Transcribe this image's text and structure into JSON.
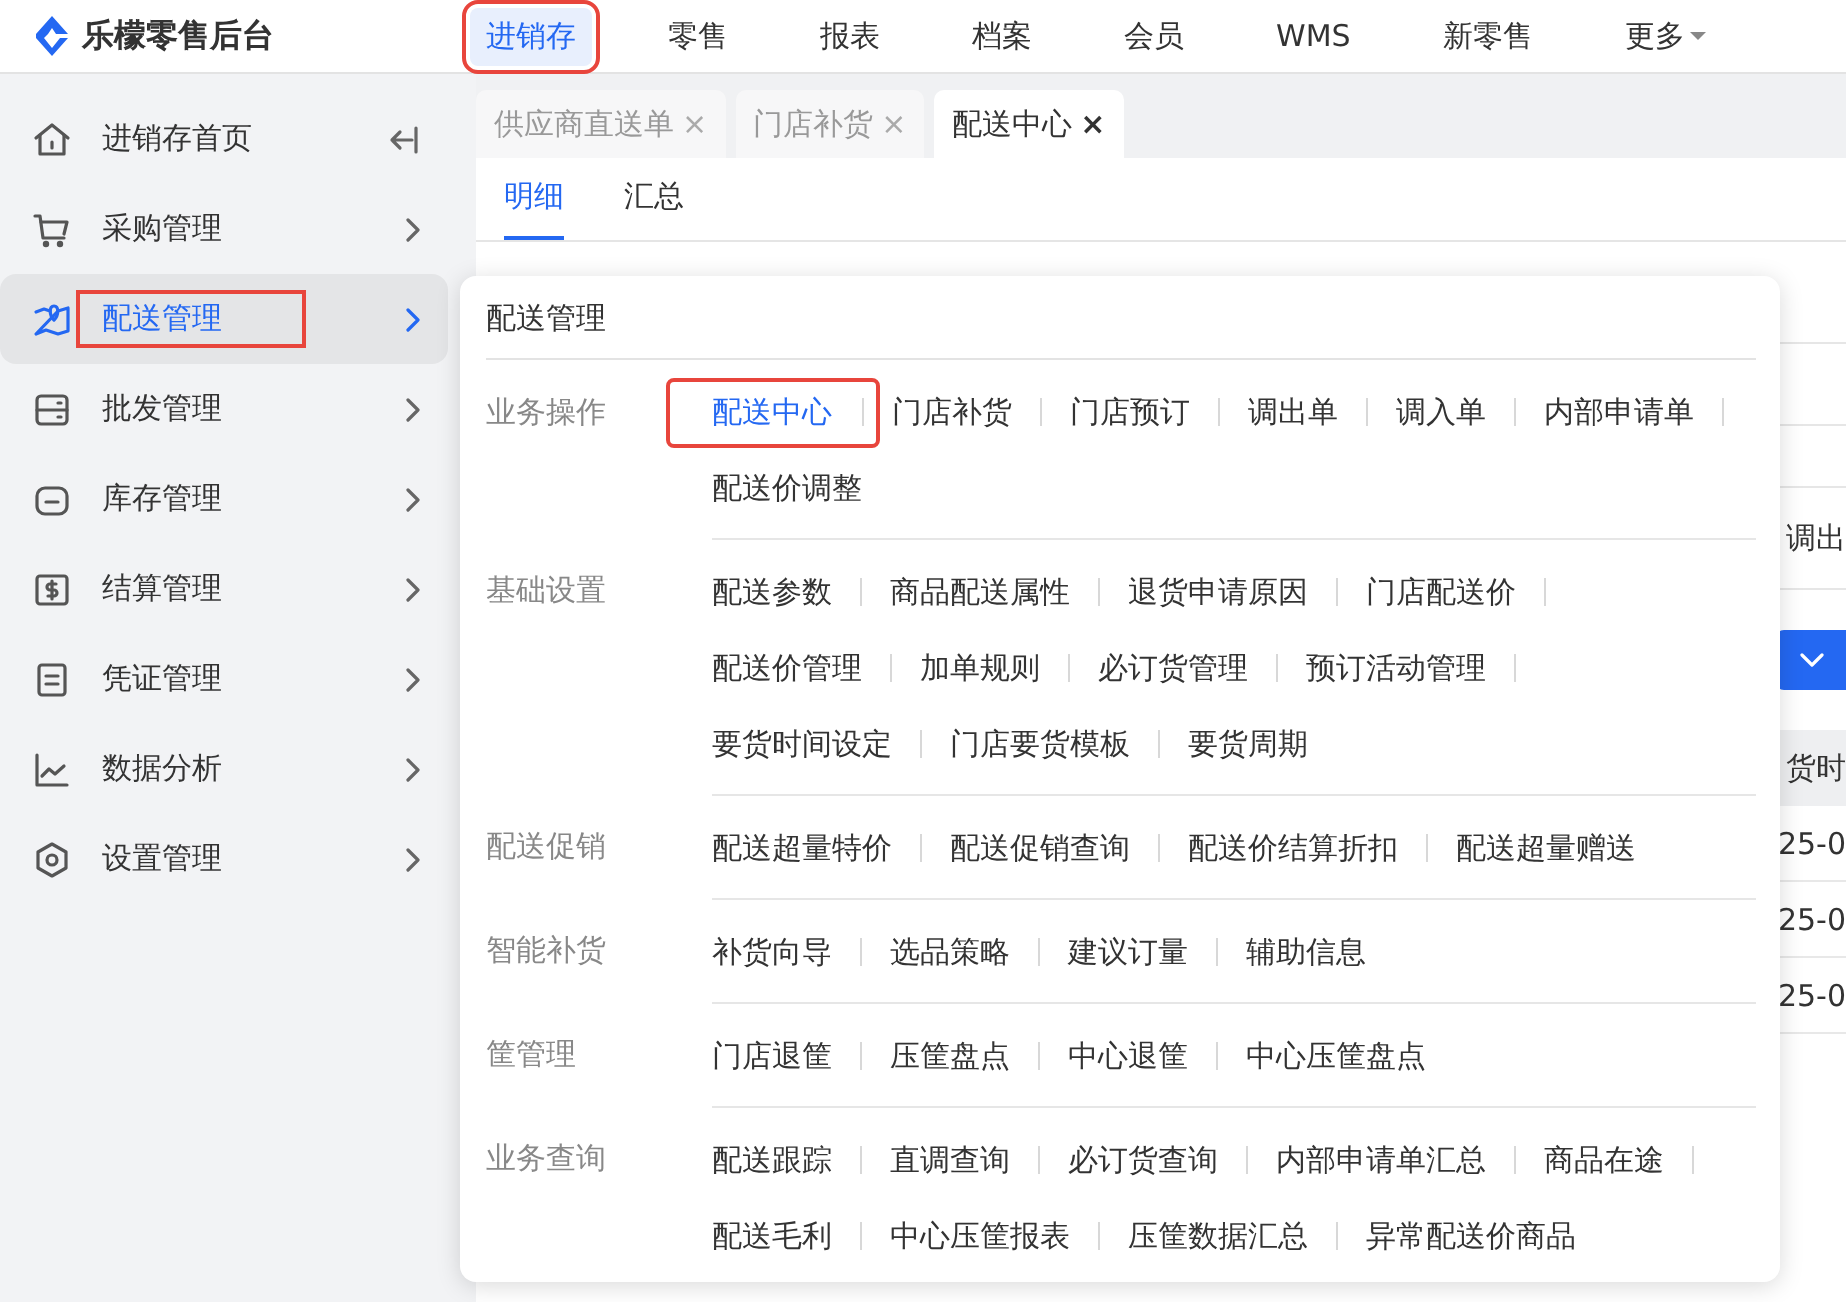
{
  "logo": {
    "title": "乐檬零售后台"
  },
  "top_nav": [
    {
      "label": "进销存",
      "selected": true,
      "annotated": true,
      "kind": "link"
    },
    {
      "label": "零售",
      "selected": false,
      "annotated": false,
      "kind": "link"
    },
    {
      "label": "报表",
      "selected": false,
      "annotated": false,
      "kind": "link"
    },
    {
      "label": "档案",
      "selected": false,
      "annotated": false,
      "kind": "link"
    },
    {
      "label": "会员",
      "selected": false,
      "annotated": false,
      "kind": "link"
    },
    {
      "label": "WMS",
      "selected": false,
      "annotated": false,
      "kind": "link"
    },
    {
      "label": "新零售",
      "selected": false,
      "annotated": false,
      "kind": "link"
    },
    {
      "label": "更多",
      "selected": false,
      "annotated": false,
      "kind": "dropdown"
    }
  ],
  "sidebar": {
    "items": [
      {
        "label": "进销存首页",
        "selected": false,
        "annotated": false,
        "kind": "page"
      },
      {
        "label": "采购管理",
        "selected": false,
        "annotated": false,
        "kind": "submenu"
      },
      {
        "label": "配送管理",
        "selected": true,
        "annotated": true,
        "kind": "submenu"
      },
      {
        "label": "批发管理",
        "selected": false,
        "annotated": false,
        "kind": "submenu"
      },
      {
        "label": "库存管理",
        "selected": false,
        "annotated": false,
        "kind": "submenu"
      },
      {
        "label": "结算管理",
        "selected": false,
        "annotated": false,
        "kind": "submenu"
      },
      {
        "label": "凭证管理",
        "selected": false,
        "annotated": false,
        "kind": "submenu"
      },
      {
        "label": "数据分析",
        "selected": false,
        "annotated": false,
        "kind": "submenu"
      },
      {
        "label": "设置管理",
        "selected": false,
        "annotated": false,
        "kind": "submenu"
      }
    ]
  },
  "tabs": [
    {
      "label": "供应商直送单",
      "close": "×",
      "selected": false
    },
    {
      "label": "门店补货",
      "close": "×",
      "selected": false
    },
    {
      "label": "配送中心",
      "close": "×",
      "selected": true
    }
  ],
  "subtabs": [
    {
      "label": "明细",
      "selected": true
    },
    {
      "label": "汇总",
      "selected": false
    }
  ],
  "background": {
    "filter_text": "调出",
    "table_header": "货时",
    "rows": [
      "25-0",
      "25-0",
      "25-0"
    ]
  },
  "dropdown": {
    "title": "配送管理",
    "sections": [
      {
        "label": "业务操作",
        "lines": [
          [
            {
              "label": "配送中心",
              "selected": true,
              "annotated": true
            },
            {
              "label": "门店补货",
              "selected": false,
              "annotated": false
            },
            {
              "label": "门店预订",
              "selected": false,
              "annotated": false
            },
            {
              "label": "调出单",
              "selected": false,
              "annotated": false
            },
            {
              "label": "调入单",
              "selected": false,
              "annotated": false
            },
            {
              "label": "内部申请单",
              "selected": false,
              "annotated": false
            }
          ],
          [
            {
              "label": "配送价调整",
              "selected": false,
              "annotated": false
            }
          ]
        ]
      },
      {
        "label": "基础设置",
        "lines": [
          [
            {
              "label": "配送参数",
              "selected": false,
              "annotated": false
            },
            {
              "label": "商品配送属性",
              "selected": false,
              "annotated": false
            },
            {
              "label": "退货申请原因",
              "selected": false,
              "annotated": false
            },
            {
              "label": "门店配送价",
              "selected": false,
              "annotated": false
            }
          ],
          [
            {
              "label": "配送价管理",
              "selected": false,
              "annotated": false
            },
            {
              "label": "加单规则",
              "selected": false,
              "annotated": false
            },
            {
              "label": "必订货管理",
              "selected": false,
              "annotated": false
            },
            {
              "label": "预订活动管理",
              "selected": false,
              "annotated": false
            }
          ],
          [
            {
              "label": "要货时间设定",
              "selected": false,
              "annotated": false
            },
            {
              "label": "门店要货模板",
              "selected": false,
              "annotated": false
            },
            {
              "label": "要货周期",
              "selected": false,
              "annotated": false
            }
          ]
        ]
      },
      {
        "label": "配送促销",
        "lines": [
          [
            {
              "label": "配送超量特价",
              "selected": false,
              "annotated": false
            },
            {
              "label": "配送促销查询",
              "selected": false,
              "annotated": false
            },
            {
              "label": "配送价结算折扣",
              "selected": false,
              "annotated": false
            },
            {
              "label": "配送超量赠送",
              "selected": false,
              "annotated": false
            }
          ]
        ]
      },
      {
        "label": "智能补货",
        "lines": [
          [
            {
              "label": "补货向导",
              "selected": false,
              "annotated": false
            },
            {
              "label": "选品策略",
              "selected": false,
              "annotated": false
            },
            {
              "label": "建议订量",
              "selected": false,
              "annotated": false
            },
            {
              "label": "辅助信息",
              "selected": false,
              "annotated": false
            }
          ]
        ]
      },
      {
        "label": "筐管理",
        "lines": [
          [
            {
              "label": "门店退筐",
              "selected": false,
              "annotated": false
            },
            {
              "label": "压筐盘点",
              "selected": false,
              "annotated": false
            },
            {
              "label": "中心退筐",
              "selected": false,
              "annotated": false
            },
            {
              "label": "中心压筐盘点",
              "selected": false,
              "annotated": false
            }
          ]
        ]
      },
      {
        "label": "业务查询",
        "lines": [
          [
            {
              "label": "配送跟踪",
              "selected": false,
              "annotated": false
            },
            {
              "label": "直调查询",
              "selected": false,
              "annotated": false
            },
            {
              "label": "必订货查询",
              "selected": false,
              "annotated": false
            },
            {
              "label": "内部申请单汇总",
              "selected": false,
              "annotated": false
            },
            {
              "label": "商品在途",
              "selected": false,
              "annotated": false
            }
          ],
          [
            {
              "label": "配送毛利",
              "selected": false,
              "annotated": false
            },
            {
              "label": "中心压筐报表",
              "selected": false,
              "annotated": false
            },
            {
              "label": "压筐数据汇总",
              "selected": false,
              "annotated": false
            },
            {
              "label": "异常配送价商品",
              "selected": false,
              "annotated": false
            }
          ]
        ]
      }
    ]
  }
}
